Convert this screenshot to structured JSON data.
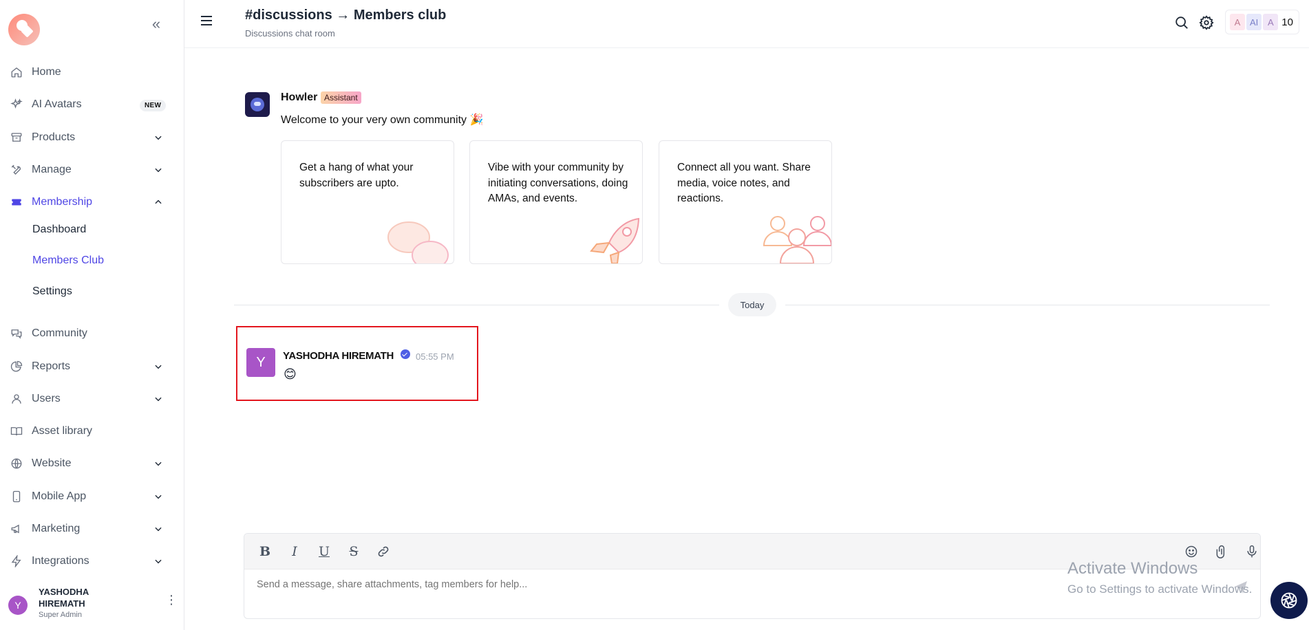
{
  "sidebar": {
    "new_badge": "NEW",
    "items": [
      {
        "label": "Home",
        "icon": "home-icon"
      },
      {
        "label": "AI Avatars",
        "icon": "sparkles-icon"
      },
      {
        "label": "Products",
        "icon": "archive-box-icon"
      },
      {
        "label": "Manage",
        "icon": "tools-icon"
      },
      {
        "label": "Membership",
        "icon": "ticket-icon"
      },
      {
        "label": "Community",
        "icon": "chat-bubbles-icon"
      },
      {
        "label": "Reports",
        "icon": "pie-chart-icon"
      },
      {
        "label": "Users",
        "icon": "user-icon"
      },
      {
        "label": "Asset library",
        "icon": "book-open-icon"
      },
      {
        "label": "Website",
        "icon": "globe-icon"
      },
      {
        "label": "Mobile App",
        "icon": "phone-icon"
      },
      {
        "label": "Marketing",
        "icon": "megaphone-icon"
      },
      {
        "label": "Integrations",
        "icon": "bolt-icon"
      }
    ],
    "membership_sub": [
      {
        "label": "Dashboard"
      },
      {
        "label": "Members Club"
      },
      {
        "label": "Settings"
      }
    ],
    "user": {
      "initial": "Y",
      "name": "YASHODHA HIREMATH",
      "role": "Super Admin"
    }
  },
  "header": {
    "title": "#discussions → Members club",
    "subtitle": "Discussions chat room",
    "credits": {
      "chip1": "A",
      "chip2": "AI",
      "chip3": "A",
      "count": "10"
    }
  },
  "assistant": {
    "name": "Howler",
    "badge": "Assistant",
    "welcome": "Welcome to your very own community 🎉",
    "cards": [
      {
        "text": "Get a hang of what your subscribers are upto."
      },
      {
        "text": "Vibe with your community by initiating conversations, doing AMAs, and events."
      },
      {
        "text": "Connect all you want. Share media, voice notes, and reactions."
      }
    ]
  },
  "divider": {
    "label": "Today"
  },
  "message": {
    "initial": "Y",
    "author": "YASHODHA HIREMATH",
    "time": "05:55 PM",
    "body": "😊"
  },
  "composer": {
    "placeholder": "Send a message, share attachments, tag members for help...",
    "bold": "B",
    "italic": "I",
    "underline": "U",
    "strike": "S"
  },
  "watermark": {
    "line1": "Activate Windows",
    "line2": "Go to Settings to activate Windows."
  },
  "colors": {
    "accent": "#4f46e5",
    "avatar": "#a855c7",
    "highlight": "#e3161e",
    "fab": "#0f1b4c"
  }
}
